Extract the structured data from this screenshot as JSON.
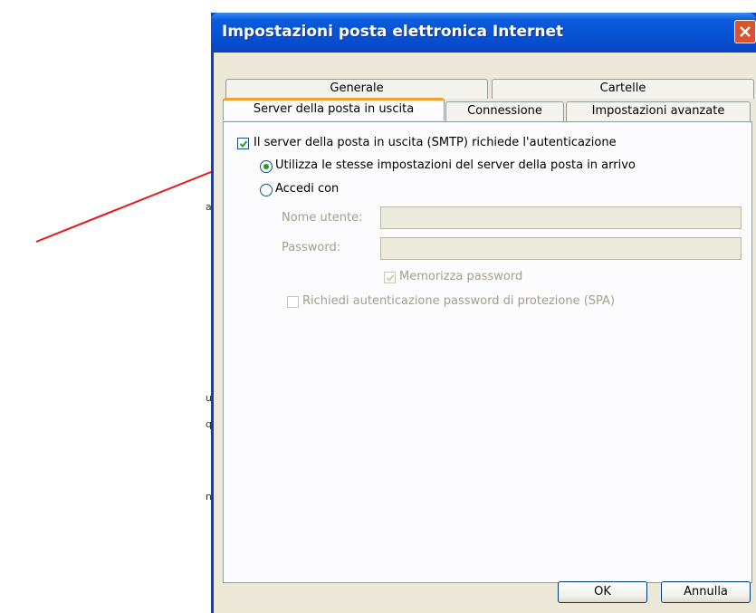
{
  "dialog": {
    "title": "Impostazioni posta elettronica Internet"
  },
  "tabs": {
    "row1": [
      "Generale",
      "Cartelle"
    ],
    "row2": [
      "Server della posta in uscita",
      "Connessione",
      "Impostazioni avanzate"
    ],
    "active": "Server della posta in uscita"
  },
  "panel": {
    "smtp_auth_label": "Il server della posta in uscita (SMTP) richiede l'autenticazione",
    "smtp_auth_checked": true,
    "radio_same_label": "Utilizza le stesse impostazioni del server della posta in arrivo",
    "radio_same_selected": true,
    "radio_login_label": "Accedi con",
    "username_label": "Nome utente:",
    "username_value": "",
    "password_label": "Password:",
    "password_value": "",
    "remember_label": "Memorizza password",
    "remember_checked": true,
    "spa_label": "Richiedi autenticazione password di protezione (SPA)",
    "spa_checked": false
  },
  "buttons": {
    "ok": "OK",
    "cancel": "Annulla"
  },
  "background_letters": [
    "a",
    "u",
    "q",
    "n"
  ],
  "colors": {
    "titlebar": "#0651d2",
    "arrow": "#e8151b",
    "radio_dot": "#21a121",
    "checkmark": "#21a121",
    "close_button": "#d9532c"
  }
}
